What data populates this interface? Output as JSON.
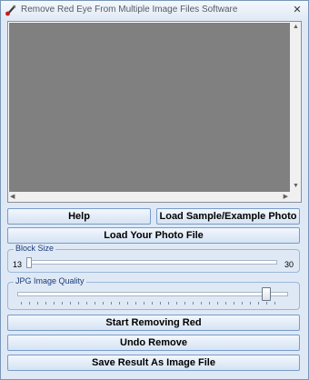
{
  "window": {
    "title": "Remove Red Eye From Multiple Image Files Software",
    "close_symbol": "✕",
    "app_icon": "red-eye-pen-icon"
  },
  "buttons": {
    "help": "Help",
    "load_sample": "Load Sample/Example Photo",
    "load_photo": "Load Your Photo File",
    "start": "Start Removing Red",
    "undo": "Undo Remove",
    "save": "Save Result As Image File"
  },
  "block_size": {
    "label": "Block Size",
    "min": "13",
    "max": "30",
    "value": 13
  },
  "jpg_quality": {
    "label": "JPG Image Quality",
    "level_fraction": 0.95
  },
  "colors": {
    "window_bg": "#dfe9f5",
    "preview_bg": "#808080"
  }
}
